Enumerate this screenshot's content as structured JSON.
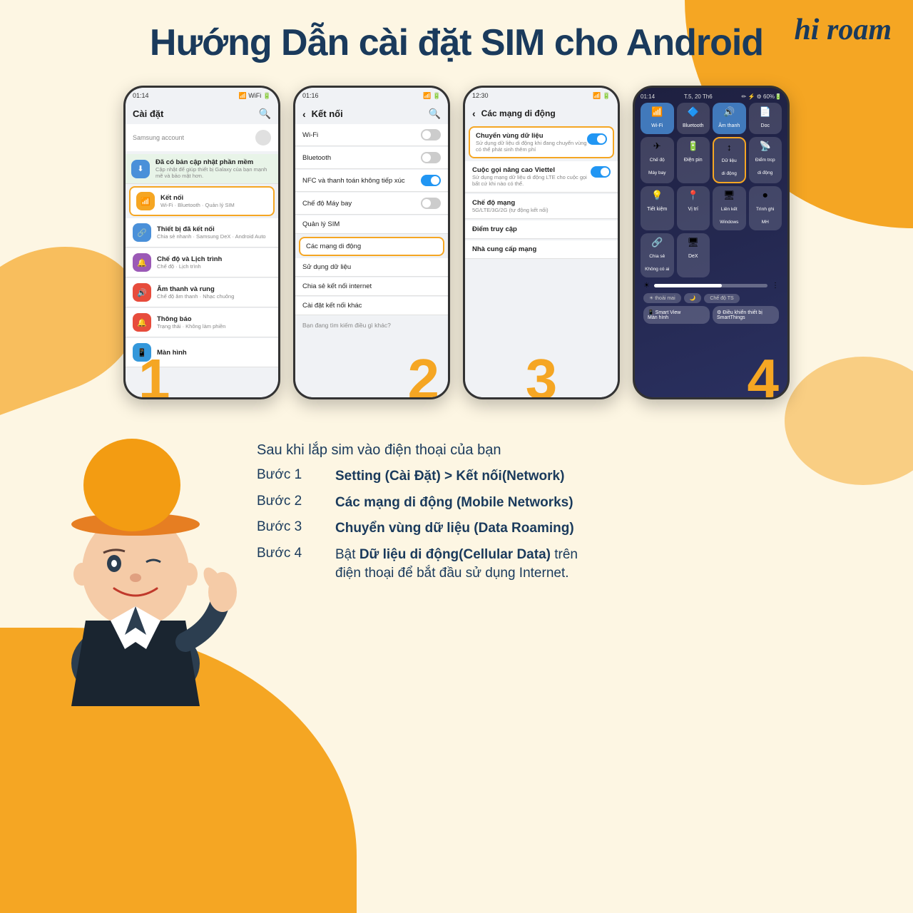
{
  "brand": {
    "logo": "hi roam",
    "logo_hi": "hi",
    "logo_roam": "roam"
  },
  "page": {
    "title": "Hướng Dẫn cài đặt SIM cho Android"
  },
  "intro": "Sau khi lắp sim vào điện thoại của bạn",
  "steps": [
    {
      "label": "Bước 1",
      "text_plain": "Setting (Cài Đặt) > Kết nối(Network)",
      "bold_part": "Setting (Cài Đặt) > Kết nối(Network)"
    },
    {
      "label": "Bước 2",
      "text_plain": "Các mạng di động (Mobile Networks)",
      "bold_part": "Các mạng di động (Mobile Networks)"
    },
    {
      "label": "Bước 3",
      "text_plain": "Chuyển vùng dữ liệu (Data Roaming)",
      "bold_part": "Chuyển vùng dữ liệu (Data Roaming)"
    },
    {
      "label": "Bước 4",
      "text_plain": "Bật Dữ liệu di động(Cellular Data) trên điện thoại để bắt đầu sử dụng Internet.",
      "bold_part": "Dữ liệu di động(Cellular Data)"
    }
  ],
  "phone1": {
    "time": "01:14",
    "title": "Cài đặt",
    "search_placeholder": "Samsung account",
    "items": [
      {
        "label": "Đã có bản cập nhật phần mềm",
        "sub": "Cập nhật để giúp thiết bị Galaxy của bạn mạnh mẽ và bảo mật hơn.",
        "color": "#4a90d9",
        "icon": "⬇"
      },
      {
        "label": "Kết nối",
        "sub": "Wi-Fi · Bluetooth · Quản lý SIM",
        "color": "#f5a623",
        "icon": "📶",
        "highlighted": true
      },
      {
        "label": "Thiết bị đã kết nối",
        "sub": "Chia sẻ nhanh · Samsung DeX · Android Auto",
        "color": "#4a90d9",
        "icon": "🔗"
      },
      {
        "label": "Chế độ và Lịch trình",
        "sub": "Chế độ · Lịch trình",
        "color": "#9b59b6",
        "icon": "🔔"
      },
      {
        "label": "Âm thanh và rung",
        "sub": "Chế độ âm thanh · Nhạc chuông",
        "color": "#e74c3c",
        "icon": "🔊"
      },
      {
        "label": "Thông báo",
        "sub": "Trạng thái · Không làm phiền",
        "color": "#e74c3c",
        "icon": "🔔"
      },
      {
        "label": "Màn hình",
        "sub": "",
        "color": "#3498db",
        "icon": "📱"
      }
    ]
  },
  "phone2": {
    "time": "01:16",
    "title": "Kết nối",
    "items": [
      {
        "label": "Wi-Fi",
        "sub": "",
        "toggle": "off"
      },
      {
        "label": "Bluetooth",
        "sub": "",
        "toggle": "off"
      },
      {
        "label": "NFC và thanh toán không tiếp xúc",
        "sub": "",
        "toggle": "on"
      },
      {
        "label": "Chế độ Máy bay",
        "sub": "",
        "toggle": "off"
      },
      {
        "label": "Quản lý SIM",
        "sub": ""
      },
      {
        "label": "Các mạng di động",
        "sub": "",
        "highlighted": true
      },
      {
        "label": "Sử dụng dữ liệu",
        "sub": ""
      },
      {
        "label": "Chia sẻ kết nối internet",
        "sub": ""
      },
      {
        "label": "Cài đặt kết nối khác",
        "sub": ""
      }
    ],
    "footer": "Bạn đang tìm kiếm điều gì khác?"
  },
  "phone3": {
    "time": "12:30",
    "title": "Các mạng di động",
    "items": [
      {
        "label": "Chuyển vùng dữ liệu",
        "sub": "Sử dụng dữ liệu di động khi đang chuyển vùng có thể phát sinh thêm phí",
        "toggle": "on",
        "highlighted": true
      },
      {
        "label": "Cuộc gọi nâng cao Viettel",
        "sub": "Sử dụng mạng dữ liệu di động LTE cho cuộc gọi bất cứ khi nào có thể.",
        "toggle": "on"
      },
      {
        "label": "Chế độ mạng",
        "sub": "5G/LTE/3G/2G (tự động kết nối)"
      },
      {
        "label": "Điểm truy cập",
        "sub": ""
      },
      {
        "label": "Nhà cung cấp mạng",
        "sub": ""
      }
    ]
  },
  "phone4": {
    "time": "01:14",
    "date": "T.5, 20 Th6",
    "tiles": [
      {
        "label": "Wi-Fi",
        "icon": "📶",
        "active": true
      },
      {
        "label": "Bluetooth",
        "icon": "🔷",
        "active": false
      },
      {
        "label": "Âm thanh",
        "icon": "🔊",
        "active": true
      },
      {
        "label": "Doc",
        "icon": "📄",
        "active": false
      },
      {
        "label": "Chế độ\nMáy bay",
        "icon": "✈",
        "active": false
      },
      {
        "label": "Điện pin",
        "icon": "🔋",
        "active": false
      },
      {
        "label": "Dữ liệu\ndi động",
        "icon": "↕",
        "active": false,
        "highlighted": true
      },
      {
        "label": "Điểm trcp\ndi động",
        "icon": "📡",
        "active": false
      },
      {
        "label": "Tiết kiệm",
        "icon": "💡",
        "active": false
      },
      {
        "label": "Vị trí",
        "icon": "📍",
        "active": false
      },
      {
        "label": "Liên kết\nWindows",
        "icon": "🖥",
        "active": false
      },
      {
        "label": "Trình ghi\nMH",
        "icon": "⏺",
        "active": false
      },
      {
        "label": "Chia sẻ\nKhông có ai",
        "icon": "🔗",
        "active": false
      },
      {
        "label": "DeX",
        "icon": "🖥",
        "active": false
      }
    ]
  }
}
